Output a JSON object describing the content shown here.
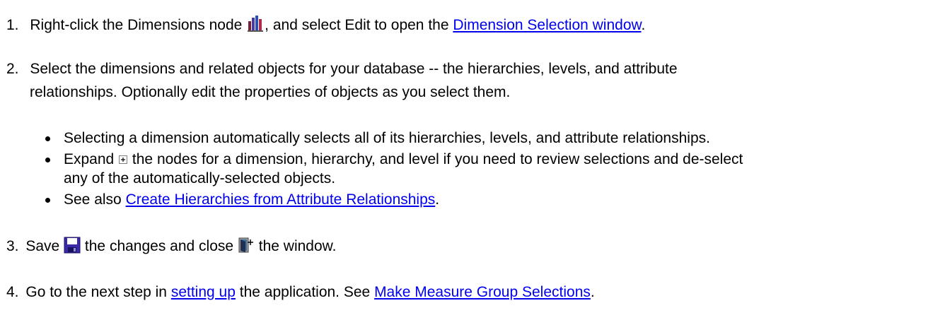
{
  "steps": {
    "step1": {
      "number": "1.",
      "text_before_icon": "Right-click the Dimensions node",
      "icon": "dimensions-node-icon",
      "text_after_icon": ", and select Edit to open the",
      "link": "Dimension Selection window",
      "end": "."
    },
    "step2": {
      "number": "2.",
      "line1": "Select the dimensions and related objects for your database -- the hierarchies, levels, and attribute",
      "line2": "relationships. Optionally edit the properties of objects as you select them.",
      "bullets": {
        "b1": "Selecting a dimension automatically selects all of its hierarchies, levels, and attribute relationships.",
        "b2_before_icon": "Expand",
        "b2_icon": "expand-plus-icon",
        "b2_after_icon": "the nodes for a dimension, hierarchy, and level if you need to review selections and de-select",
        "b2_line2": "any of the automatically-selected objects.",
        "b3_before": "See also",
        "b3_link": "Create Hierarchies from Attribute Relationships",
        "b3_end": "."
      }
    },
    "step3": {
      "number": "3.",
      "text_before_save": "Save",
      "save_icon": "save-icon",
      "text_middle": "the changes and close",
      "close_icon": "close-window-icon",
      "text_end": "the window."
    },
    "step4": {
      "number": "4.",
      "text_before_link": "Go to the next step in",
      "link1": "setting up",
      "text_middle": "the application. See",
      "link2": "Make Measure Group Selections",
      "end": "."
    }
  },
  "colors": {
    "link": "#0000ee",
    "text": "#000000"
  }
}
